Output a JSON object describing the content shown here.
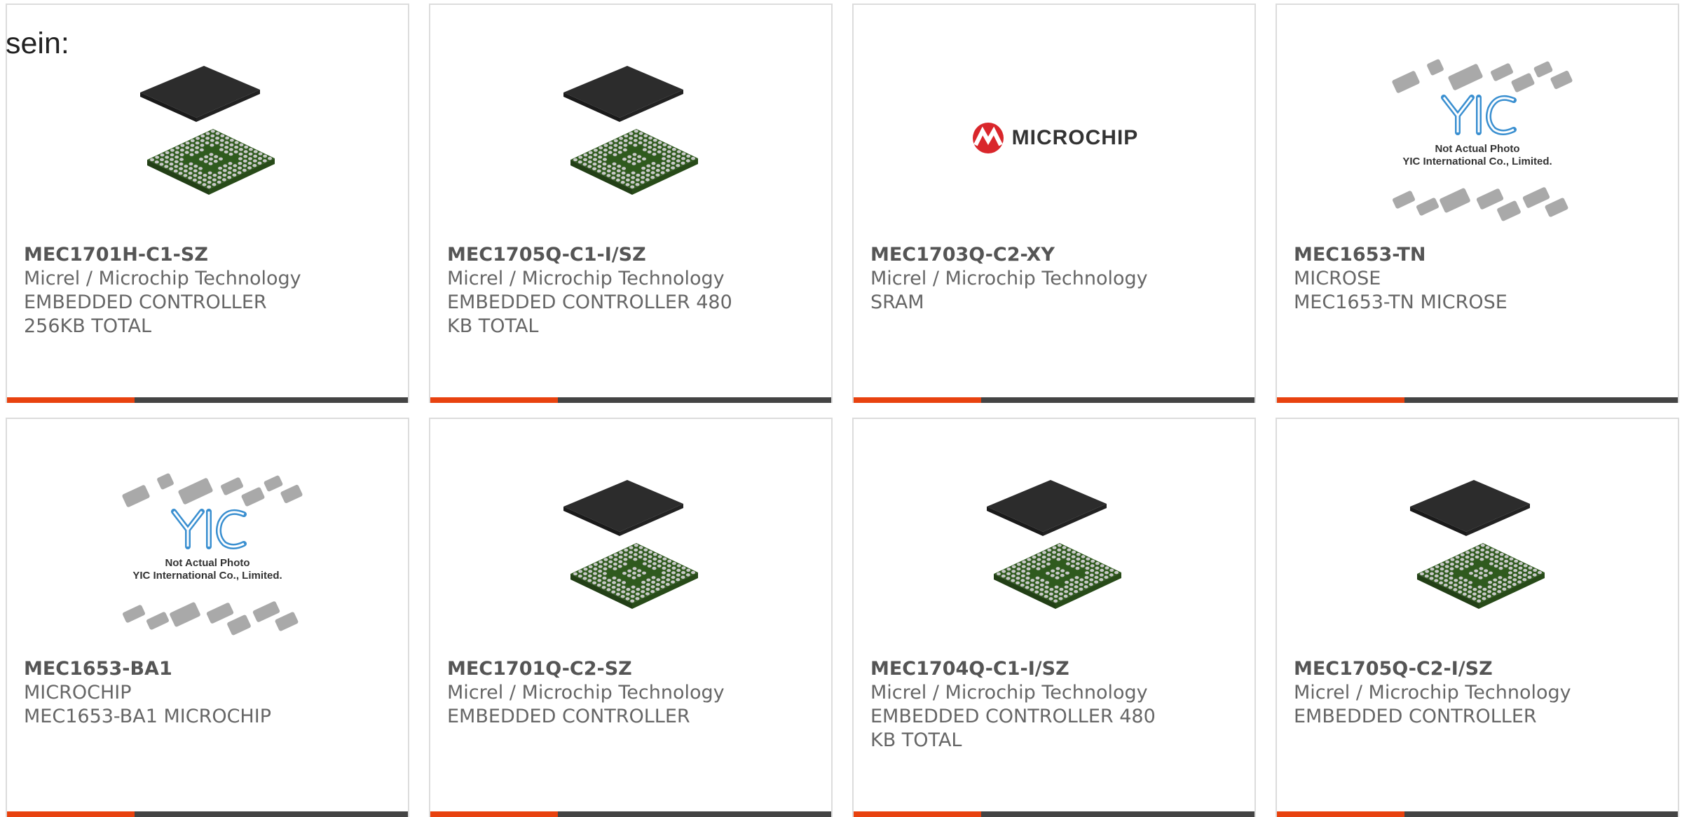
{
  "heading": "sein:",
  "colors": {
    "accent": "#e8420f",
    "bar": "#444444",
    "border": "#dcdcdc"
  },
  "products": [
    {
      "part": "MEC1701H-C1-SZ",
      "maker": "Micrel / Microchip Technology",
      "desc": "EMBEDDED CONTROLLER 256KB TOTAL",
      "image": "bga-chip-photo"
    },
    {
      "part": "MEC1705Q-C1-I/SZ",
      "maker": "Micrel / Microchip Technology",
      "desc": "EMBEDDED CONTROLLER 480 KB TOTAL",
      "image": "bga-chip-photo"
    },
    {
      "part": "MEC1703Q-C2-XY",
      "maker": "Micrel / Microchip Technology",
      "desc": "SRAM",
      "image": "microchip-logo",
      "logo_text": "MICROCHIP"
    },
    {
      "part": "MEC1653-TN",
      "maker": "MICROSE",
      "desc": "MEC1653-TN MICROSE",
      "image": "yic-placeholder",
      "ph_line1": "Not Actual Photo",
      "ph_line2": "YIC International Co., Limited."
    },
    {
      "part": "MEC1653-BA1",
      "maker": "MICROCHIP",
      "desc": "MEC1653-BA1 MICROCHIP",
      "image": "yic-placeholder",
      "ph_line1": "Not Actual Photo",
      "ph_line2": "YIC International Co., Limited."
    },
    {
      "part": "MEC1701Q-C2-SZ",
      "maker": "Micrel / Microchip Technology",
      "desc": "EMBEDDED CONTROLLER",
      "image": "bga-chip-photo"
    },
    {
      "part": "MEC1704Q-C1-I/SZ",
      "maker": "Micrel / Microchip Technology",
      "desc": "EMBEDDED CONTROLLER 480 KB TOTAL",
      "image": "bga-chip-photo"
    },
    {
      "part": "MEC1705Q-C2-I/SZ",
      "maker": "Micrel / Microchip Technology",
      "desc": "EMBEDDED CONTROLLER",
      "image": "bga-chip-photo"
    }
  ]
}
